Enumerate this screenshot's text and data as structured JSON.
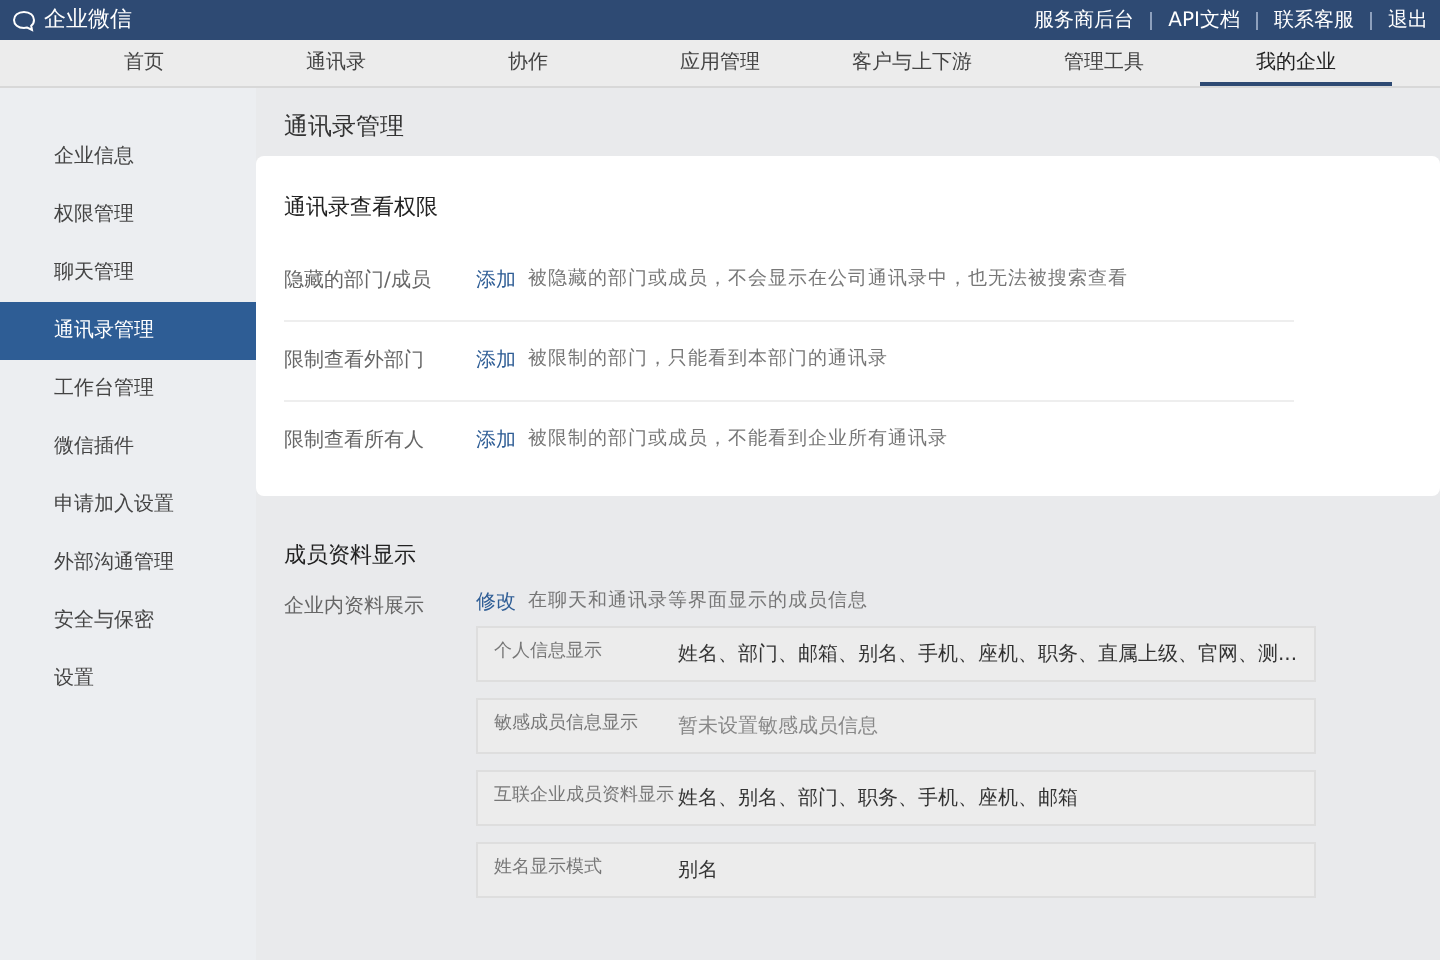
{
  "header": {
    "logo": "企业微信",
    "links": [
      "服务商后台",
      "API文档",
      "联系客服",
      "退出"
    ]
  },
  "tabs": [
    {
      "label": "首页",
      "selected": false
    },
    {
      "label": "通讯录",
      "selected": false
    },
    {
      "label": "协作",
      "selected": false
    },
    {
      "label": "应用管理",
      "selected": false
    },
    {
      "label": "客户与上下游",
      "selected": false
    },
    {
      "label": "管理工具",
      "selected": false
    },
    {
      "label": "我的企业",
      "selected": true
    }
  ],
  "sidebar": {
    "items": [
      {
        "label": "企业信息",
        "selected": false
      },
      {
        "label": "权限管理",
        "selected": false
      },
      {
        "label": "聊天管理",
        "selected": false
      },
      {
        "label": "通讯录管理",
        "selected": true
      },
      {
        "label": "工作台管理",
        "selected": false
      },
      {
        "label": "微信插件",
        "selected": false
      },
      {
        "label": "申请加入设置",
        "selected": false
      },
      {
        "label": "外部沟通管理",
        "selected": false
      },
      {
        "label": "安全与保密",
        "selected": false
      },
      {
        "label": "设置",
        "selected": false
      }
    ]
  },
  "page_title": "通讯录管理",
  "view_permissions": {
    "title": "通讯录查看权限",
    "rows": [
      {
        "label": "隐藏的部门/成员",
        "action": "添加",
        "description": "被隐藏的部门或成员，不会显示在公司通讯录中，也无法被搜索查看"
      },
      {
        "label": "限制查看外部门",
        "action": "添加",
        "description": "被限制的部门，只能看到本部门的通讯录"
      },
      {
        "label": "限制查看所有人",
        "action": "添加",
        "description": "被限制的部门或成员，不能看到企业所有通讯录"
      }
    ]
  },
  "member_display": {
    "title": "成员资料显示",
    "label": "企业内资料展示",
    "action": "修改",
    "description": "在聊天和通讯录等界面显示的成员信息",
    "fields": [
      {
        "name": "个人信息显示",
        "value": "姓名、部门、邮箱、别名、手机、座机、职务、直属上级、官网、测...",
        "empty": false
      },
      {
        "name": "敏感成员信息显示",
        "value": "暂未设置敏感成员信息",
        "empty": true
      },
      {
        "name": "互联企业成员资料显示",
        "value": "姓名、别名、部门、职务、手机、座机、邮箱",
        "empty": false
      },
      {
        "name": "姓名显示模式",
        "value": "别名",
        "empty": false
      }
    ]
  }
}
